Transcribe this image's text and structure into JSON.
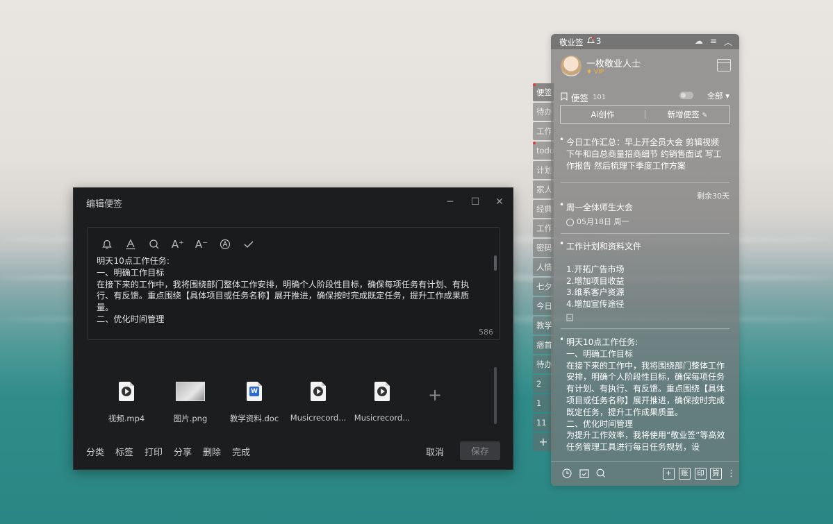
{
  "editor": {
    "title": "编辑便签",
    "window_controls": [
      "minimize-icon",
      "maximize-icon",
      "close-icon"
    ],
    "toolbar_icons": [
      "bell-icon",
      "text-color-icon",
      "search-icon",
      "font-increase-icon",
      "font-decrease-icon",
      "font-style-icon",
      "check-icon"
    ],
    "toolbar_glyphs": {
      "font_up": "A⁺",
      "font_down": "A⁻"
    },
    "content_lines": [
      "明天10点工作任务:",
      "一、明确工作目标",
      "在接下来的工作中，我将围绕部门整体工作安排，明确个人阶段性目标，确保每项任务有计划、有执行、有反馈。重点围绕【具体项目或任务名称】展开推进，确保按时完成既定任务，提升工作成果质量。",
      "二、优化时间管理"
    ],
    "char_count": "586",
    "attachments": [
      {
        "name": "视频.mp4",
        "icon": "video-file-icon"
      },
      {
        "name": "图片.png",
        "icon": "image-file-icon"
      },
      {
        "name": "教学资料.doc",
        "icon": "word-file-icon"
      },
      {
        "name": "Musicrecord...",
        "icon": "audio-file-icon"
      },
      {
        "name": "Musicrecord...",
        "icon": "audio-file-icon"
      }
    ],
    "add_attachment": "+",
    "footer_actions": [
      "分类",
      "标签",
      "打印",
      "分享",
      "删除",
      "完成"
    ],
    "cancel_label": "取消",
    "save_label": "保存"
  },
  "side_tabs": [
    "便签",
    "待办",
    "工作",
    "todo",
    "计划",
    "家人",
    "经典",
    "工作",
    "密码",
    "人情",
    "七夕",
    "今日",
    "教学",
    "痞首",
    "待办",
    "2",
    "1",
    "11"
  ],
  "side_tab_add": "+",
  "panel": {
    "app_name": "敬业签",
    "notification_count": "3",
    "user_name": "一枚敬业人士",
    "vip_label": "VIP",
    "section_label": "便签",
    "section_count": "101",
    "filter_label": "全部",
    "ai_button": "Ai创作",
    "new_note_button": "新增便签",
    "notes": [
      {
        "text": "今日工作汇总：早上开全员大会 剪辑视频 下午和白总商量招商细节 约销售面试 写工作报告 然后梳理下季度工作方案"
      },
      {
        "remaining": "剩余30天",
        "text": "周一全体师生大会",
        "date": "05月18日 周一"
      },
      {
        "text": "工作计划和资料文件",
        "items": [
          "1.开拓广告市场",
          "2.增加项目收益",
          "3.维系客户资源",
          "4.增加宣传途径"
        ]
      },
      {
        "text": "明天10点工作任务:\n一、明确工作目标\n在接下来的工作中，我将围绕部门整体工作安排，明确个人阶段性目标，确保每项任务有计划、有执行、有反馈。重点围绕【具体项目或任务名称】展开推进，确保按时完成既定任务，提升工作成果质量。\n二、优化时间管理\n为提升工作效率，我将使用“敬业签”等高效任务管理工具进行每日任务规划，设"
      }
    ],
    "footer_buttons": [
      "+",
      "账",
      "印",
      "算"
    ]
  },
  "colors": {
    "vip": "#f3b23a",
    "notify_dot": "#e53b3b",
    "word_blue": "#2b6cd3"
  }
}
